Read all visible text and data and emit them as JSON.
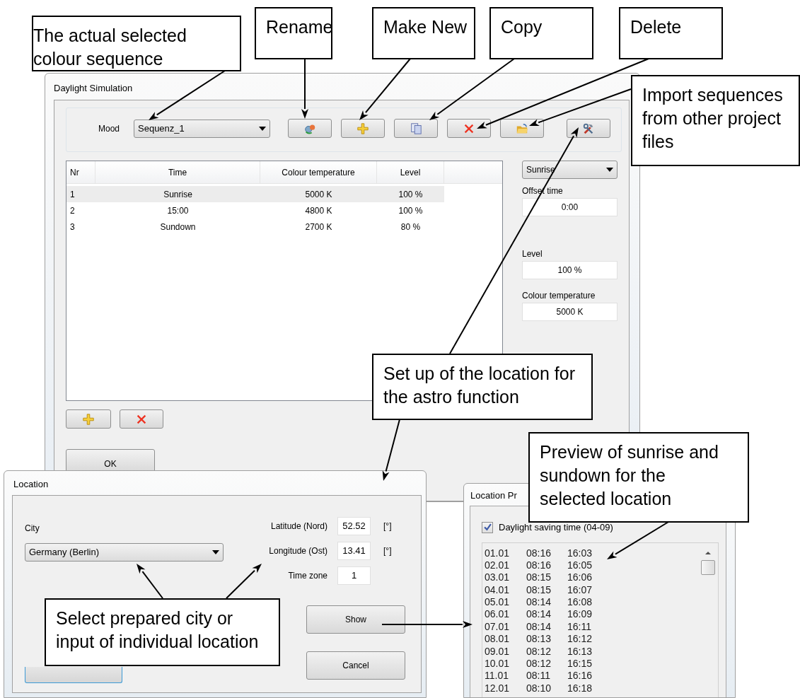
{
  "daylight_simulation": {
    "title": "Daylight Simulation",
    "mood_label": "Mood",
    "mood_value": "Sequenz_1",
    "toolbar_buttons": [
      {
        "kind": "rename"
      },
      {
        "kind": "new"
      },
      {
        "kind": "copy"
      },
      {
        "kind": "delete"
      },
      {
        "kind": "import"
      },
      {
        "kind": "tools"
      }
    ],
    "table": {
      "columns": [
        "Nr",
        "Time",
        "Colour temperature",
        "Level"
      ],
      "rows": [
        {
          "cells": [
            "1",
            "Sunrise",
            "5000 K",
            "100 %"
          ],
          "selected": true
        },
        {
          "cells": [
            "2",
            "15:00",
            "4800 K",
            "100 %"
          ],
          "selected": false
        },
        {
          "cells": [
            "3",
            "Sundown",
            "2700 K",
            "80 %"
          ],
          "selected": false
        }
      ]
    },
    "event_dropdown": "Sunrise",
    "fields": [
      {
        "label": "Offset time",
        "value": "0:00"
      },
      {
        "label": "Level",
        "value": "100 %"
      },
      {
        "label": "Colour temperature",
        "value": "5000 K"
      }
    ],
    "row_buttons": [
      {
        "kind": "new"
      },
      {
        "kind": "delete"
      }
    ],
    "ok_button": "OK"
  },
  "location": {
    "title": "Location",
    "city_label": "City",
    "city_value": "Germany (Berlin)",
    "fields": [
      {
        "label": "Latitude (Nord)",
        "value": "52.52",
        "unit": "[°]"
      },
      {
        "label": "Longitude (Ost)",
        "value": "13.41",
        "unit": "[°]"
      },
      {
        "label": "Time zone",
        "value": "1"
      }
    ],
    "show_button": "Show",
    "cancel_button": "Cancel"
  },
  "location_preview": {
    "title": "Location Pr",
    "daylight_saving": {
      "label": "Daylight saving time (04-09)",
      "checked": true
    },
    "rows": [
      [
        "01.01",
        "08:16",
        "16:03"
      ],
      [
        "02.01",
        "08:16",
        "16:05"
      ],
      [
        "03.01",
        "08:15",
        "16:06"
      ],
      [
        "04.01",
        "08:15",
        "16:07"
      ],
      [
        "05.01",
        "08:14",
        "16:08"
      ],
      [
        "06.01",
        "08:14",
        "16:09"
      ],
      [
        "07.01",
        "08:14",
        "16:11"
      ],
      [
        "08.01",
        "08:13",
        "16:12"
      ],
      [
        "09.01",
        "08:12",
        "16:13"
      ],
      [
        "10.01",
        "08:12",
        "16:15"
      ],
      [
        "11.01",
        "08:11",
        "16:16"
      ],
      [
        "12.01",
        "08:10",
        "16:18"
      ]
    ]
  },
  "callouts": [
    {
      "text": "The actual selected colour sequence"
    },
    {
      "text": "Rename"
    },
    {
      "text": "Make New"
    },
    {
      "text": "Copy"
    },
    {
      "text": "Delete"
    },
    {
      "text": "Import sequences from other project files"
    },
    {
      "text": "Set up of the location for the astro function"
    },
    {
      "text": "Preview of sunrise and sundown for the selected location"
    },
    {
      "text": "Select prepared city or input of individual location"
    }
  ]
}
